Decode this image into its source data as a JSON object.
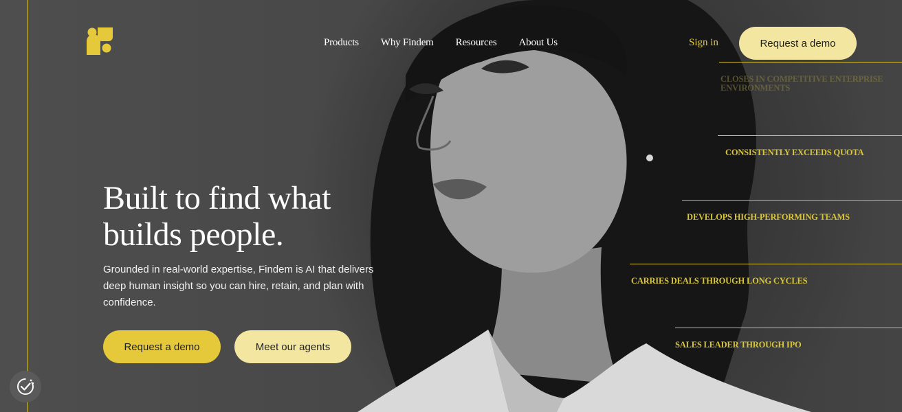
{
  "nav": {
    "items": [
      "Products",
      "Why Findem",
      "Resources",
      "About Us"
    ],
    "sign_in": "Sign in",
    "request_demo": "Request a demo"
  },
  "hero": {
    "headline_line1": "Built to find what",
    "headline_line2": "builds people.",
    "subtext": "Grounded in real-world expertise, Findem is AI that delivers deep human insight so you can hire, retain, and plan with confidence.",
    "primary_cta": "Request a demo",
    "secondary_cta": "Meet our agents"
  },
  "tags": [
    "CLOSES IN COMPETITIVE ENTERPRISE ENVIRONMENTS",
    "CONSISTENTLY EXCEEDS QUOTA",
    "DEVELOPS HIGH-PERFORMING TEAMS",
    "CARRIES DEALS THROUGH LONG CYCLES",
    "SALES LEADER THROUGH IPO"
  ],
  "colors": {
    "accent": "#e6c93a",
    "accent_light": "#f2e6a0",
    "background": "#4a4a4a"
  },
  "icons": {
    "logo": "findem-logo",
    "cookie": "cookie-consent-icon"
  }
}
